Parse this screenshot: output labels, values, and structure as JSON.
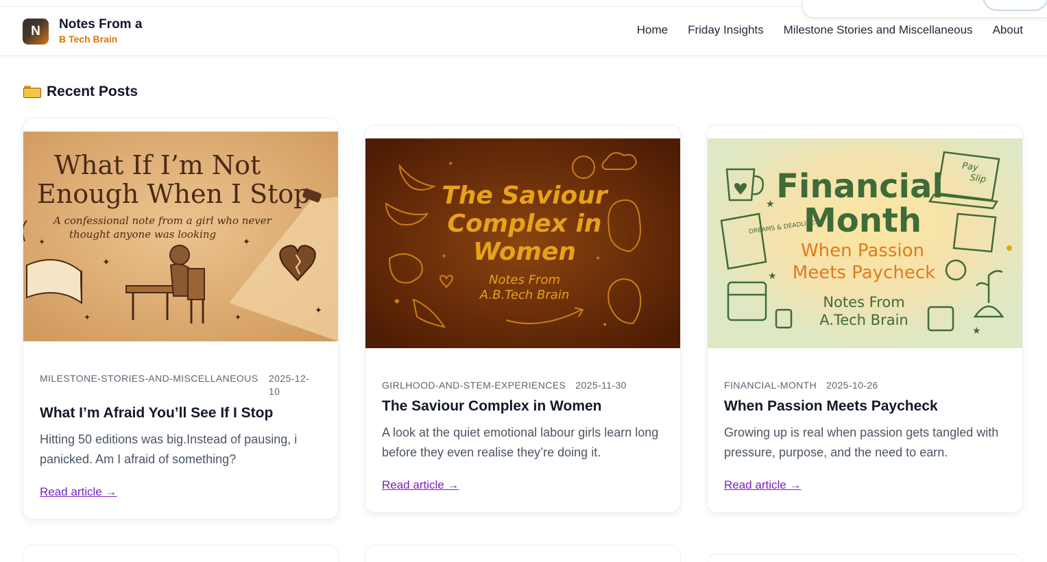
{
  "site": {
    "logo_letter": "N",
    "title": "Notes From a",
    "subtitle": "B Tech Brain"
  },
  "nav": {
    "items": [
      {
        "label": "Home"
      },
      {
        "label": "Friday Insights"
      },
      {
        "label": "Milestone Stories and Miscellaneous"
      },
      {
        "label": "About"
      }
    ]
  },
  "section": {
    "title": "Recent Posts",
    "icon": "folder-icon"
  },
  "posts": [
    {
      "category": "MILESTONE-STORIES-AND-MISCELLANEOUS",
      "date": "2025-12-10",
      "title": "What I’m Afraid You’ll See If I Stop",
      "excerpt": "Hitting 50 editions was big.Instead of pausing, i panicked. Am I afraid of something?",
      "link": "Read article →",
      "image": {
        "heading_line1": "What If I’m Not",
        "heading_line2": "Enough When I Stop",
        "caption_line1": "A confessional note from a girl who never",
        "caption_line2": "thought anyone was looking",
        "background": "#e0b07d"
      }
    },
    {
      "category": "GIRLHOOD-AND-STEM-EXPERIENCES",
      "date": "2025-11-30",
      "title": "The Saviour Complex in Women",
      "excerpt": "A look at the quiet emotional labour girls learn long before they even realise they’re doing it.",
      "link": "Read article →",
      "image": {
        "heading_line1": "The Saviour",
        "heading_line2": "Complex in",
        "heading_line3": "Women",
        "caption_line1": "Notes From",
        "caption_line2": "A.B.Tech Brain",
        "background": "#6b2e08"
      }
    },
    {
      "category": "FINANCIAL-MONTH",
      "date": "2025-10-26",
      "title": "When Passion Meets Paycheck",
      "excerpt": "Growing up is real when passion gets tangled with pressure, purpose, and the need to earn.",
      "link": "Read article →",
      "image": {
        "heading_line1": "Financial",
        "heading_line2": "Month",
        "sub_line1": "When Passion",
        "sub_line2": "Meets Paycheck",
        "caption_line1": "Notes From",
        "caption_line2": "A.Tech Brain",
        "doodle_left": "DREAMS & DEADLINES",
        "doodle_right_1": "Pay",
        "doodle_right_2": "Slip",
        "background": "#dfe8c4"
      }
    }
  ],
  "colors": {
    "accent": "#d97706",
    "link": "#7b1fc4",
    "text": "#111827",
    "muted": "#5b6472"
  }
}
